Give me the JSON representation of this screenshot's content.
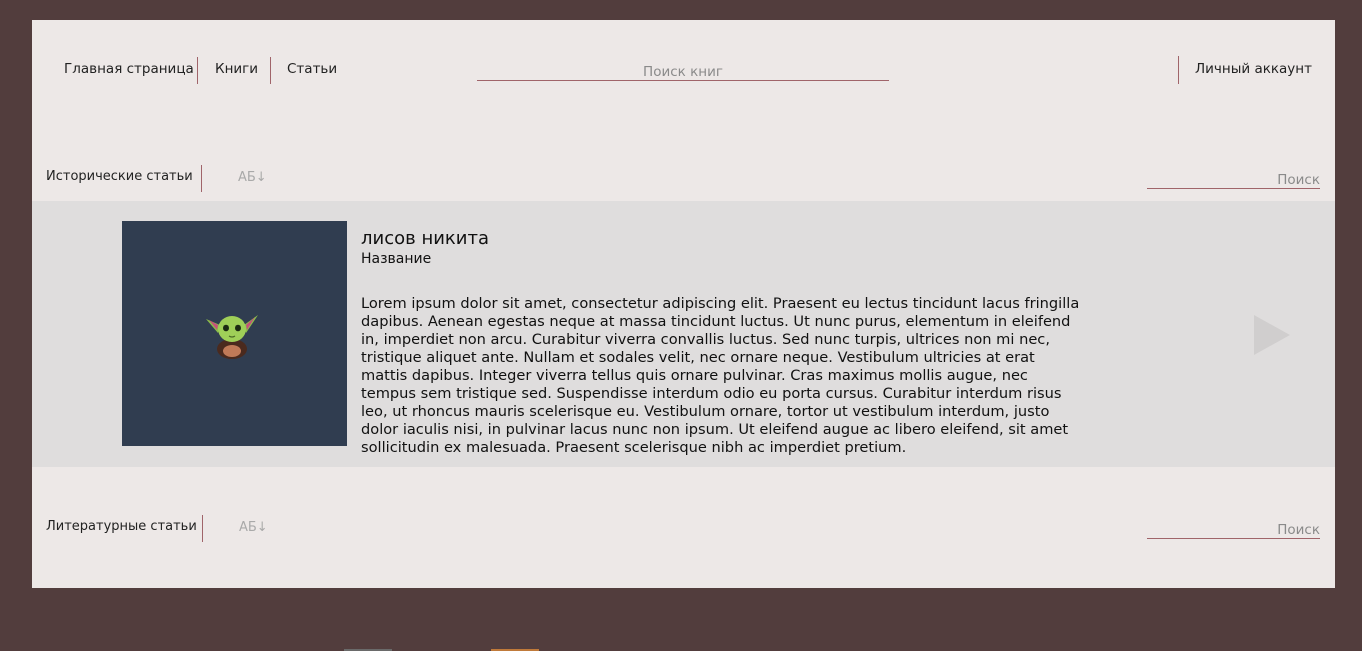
{
  "nav": {
    "home": "Главная страница",
    "books": "Книги",
    "articles": "Статьи",
    "search_placeholder": "Поиск книг",
    "account": "Личный аккаунт"
  },
  "sections": [
    {
      "title": "Исторические статьи",
      "sort_label": "АБ↓",
      "search_placeholder": "Поиск"
    },
    {
      "title": "Литературные статьи",
      "sort_label": "АБ↓",
      "search_placeholder": "Поиск"
    }
  ],
  "article": {
    "author": "лисов никита",
    "title": "Название",
    "body": "Lorem ipsum dolor sit amet, consectetur adipiscing elit. Praesent eu lectus tincidunt lacus fringilla dapibus. Aenean egestas neque at massa tincidunt luctus. Ut nunc purus, elementum in eleifend in, imperdiet non arcu. Curabitur viverra convallis luctus. Sed nunc turpis, ultrices non mi nec, tristique aliquet ante. Nullam et sodales velit, nec ornare neque. Vestibulum ultricies at erat mattis dapibus. Integer viverra tellus quis ornare pulvinar. Cras maximus mollis augue, nec tempus sem tristique sed. Suspendisse interdum odio eu porta cursus. Curabitur interdum risus leo, ut rhoncus mauris scelerisque eu. Vestibulum ornare, tortor ut vestibulum interdum, justo dolor iaculis nisi, in pulvinar lacus nunc non ipsum. Ut eleifend augue ac libero eleifend, sit amet sollicitudin ex malesuada. Praesent scelerisque nibh ac imperdiet pretium.",
    "image_icon": "yoda-avatar-icon",
    "next_icon": "play-arrow-icon"
  },
  "colors": {
    "outer_bg": "#523d3d",
    "page_bg": "#ede8e7",
    "band_bg": "#dfdddd",
    "thumb_bg": "#303d50",
    "accent_line": "#a0646a"
  }
}
